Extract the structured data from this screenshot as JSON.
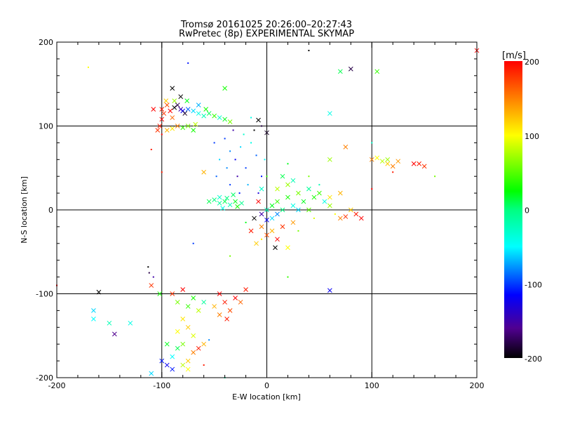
{
  "chart_data": {
    "type": "scatter",
    "title": "Tromsø 20161025 20:26:00–20:27:43",
    "subtitle": "RwPretec (8p) EXPERIMENTAL SKYMAP",
    "xlabel": "E-W location [km]",
    "ylabel": "N-S location [km]",
    "xlim": [
      -200,
      200
    ],
    "ylim": [
      -200,
      200
    ],
    "xticks": [
      "-200",
      "-100",
      "0",
      "100",
      "200"
    ],
    "yticks": [
      "-200",
      "-100",
      "0",
      "100",
      "200"
    ],
    "grid": true,
    "colorbar": {
      "label": "[m/s]",
      "range": [
        -200,
        200
      ],
      "ticks": [
        "200",
        "100",
        "0",
        "-100",
        "-200"
      ],
      "stops": [
        [
          -200,
          "#000000"
        ],
        [
          -160,
          "#500090"
        ],
        [
          -115,
          "#0000ff"
        ],
        [
          -50,
          "#00ffff"
        ],
        [
          0,
          "#00ff80"
        ],
        [
          25,
          "#00ff00"
        ],
        [
          100,
          "#ffff00"
        ],
        [
          150,
          "#ff8000"
        ],
        [
          200,
          "#ff0000"
        ]
      ]
    },
    "point_fields": [
      "x_km",
      "y_km",
      "velocity_mps",
      "cross_marker"
    ],
    "points": [
      [
        -100,
        120,
        190,
        1
      ],
      [
        -98,
        115,
        180,
        1
      ],
      [
        -95,
        125,
        170,
        1
      ],
      [
        -92,
        118,
        200,
        1
      ],
      [
        -90,
        110,
        160,
        1
      ],
      [
        -88,
        122,
        -200,
        1
      ],
      [
        -85,
        125,
        -180,
        1
      ],
      [
        -82,
        120,
        -150,
        1
      ],
      [
        -80,
        118,
        -120,
        1
      ],
      [
        -78,
        115,
        -190,
        1
      ],
      [
        -75,
        120,
        -90,
        1
      ],
      [
        -70,
        118,
        -60,
        1
      ],
      [
        -65,
        115,
        -40,
        1
      ],
      [
        -60,
        112,
        -20,
        1
      ],
      [
        -55,
        115,
        10,
        1
      ],
      [
        -50,
        112,
        40,
        1
      ],
      [
        -45,
        110,
        -30,
        1
      ],
      [
        -40,
        108,
        20,
        1
      ],
      [
        -35,
        105,
        60,
        1
      ],
      [
        -102,
        100,
        190,
        1
      ],
      [
        -95,
        95,
        130,
        1
      ],
      [
        -90,
        97,
        110,
        1
      ],
      [
        -85,
        100,
        150,
        1
      ],
      [
        -80,
        98,
        40,
        1
      ],
      [
        -75,
        100,
        60,
        1
      ],
      [
        -70,
        95,
        30,
        1
      ],
      [
        -68,
        102,
        80,
        1
      ],
      [
        -100,
        108,
        200,
        1
      ],
      [
        -104,
        95,
        180,
        1
      ],
      [
        -108,
        120,
        200,
        1
      ],
      [
        -96,
        130,
        120,
        1
      ],
      [
        -88,
        130,
        70,
        1
      ],
      [
        -82,
        135,
        -200,
        1
      ],
      [
        -76,
        130,
        20,
        1
      ],
      [
        -65,
        125,
        -70,
        1
      ],
      [
        -58,
        120,
        30,
        1
      ],
      [
        -100,
        90,
        200,
        0
      ],
      [
        -110,
        72,
        190,
        0
      ],
      [
        -40,
        85,
        -100,
        0
      ],
      [
        -35,
        70,
        -80,
        0
      ],
      [
        -30,
        60,
        -120,
        0
      ],
      [
        -25,
        75,
        -60,
        0
      ],
      [
        -20,
        50,
        -100,
        0
      ],
      [
        -15,
        80,
        -40,
        0
      ],
      [
        -10,
        65,
        -90,
        0
      ],
      [
        -5,
        40,
        -110,
        0
      ],
      [
        -18,
        30,
        -70,
        0
      ],
      [
        -28,
        40,
        -150,
        0
      ],
      [
        -35,
        30,
        -100,
        0
      ],
      [
        -12,
        95,
        -200,
        0
      ],
      [
        -5,
        100,
        -180,
        0
      ],
      [
        0,
        92,
        -190,
        1
      ],
      [
        -8,
        107,
        -200,
        1
      ],
      [
        -50,
        80,
        -100,
        0
      ],
      [
        -45,
        60,
        -60,
        0
      ],
      [
        -22,
        90,
        -30,
        0
      ],
      [
        -8,
        20,
        -130,
        0
      ],
      [
        -38,
        50,
        -80,
        0
      ],
      [
        -32,
        95,
        -150,
        0
      ],
      [
        -2,
        60,
        -50,
        0
      ],
      [
        -48,
        40,
        -90,
        0
      ],
      [
        -26,
        20,
        -110,
        0
      ],
      [
        -50,
        12,
        0,
        1
      ],
      [
        -45,
        8,
        -10,
        1
      ],
      [
        -40,
        10,
        10,
        1
      ],
      [
        -35,
        6,
        -20,
        1
      ],
      [
        -30,
        10,
        20,
        1
      ],
      [
        -45,
        15,
        -30,
        1
      ],
      [
        -38,
        14,
        0,
        1
      ],
      [
        -28,
        4,
        30,
        1
      ],
      [
        -55,
        10,
        10,
        1
      ],
      [
        -42,
        2,
        -40,
        1
      ],
      [
        -32,
        18,
        5,
        1
      ],
      [
        -24,
        8,
        -5,
        1
      ],
      [
        0,
        0,
        -20,
        1
      ],
      [
        5,
        5,
        20,
        1
      ],
      [
        10,
        10,
        40,
        1
      ],
      [
        15,
        0,
        0,
        1
      ],
      [
        20,
        15,
        30,
        1
      ],
      [
        25,
        5,
        -40,
        1
      ],
      [
        30,
        20,
        60,
        1
      ],
      [
        35,
        10,
        20,
        1
      ],
      [
        40,
        25,
        -10,
        1
      ],
      [
        45,
        15,
        30,
        1
      ],
      [
        5,
        -10,
        -60,
        1
      ],
      [
        10,
        -5,
        -80,
        1
      ],
      [
        0,
        -12,
        -120,
        1
      ],
      [
        -5,
        -5,
        -150,
        1
      ],
      [
        20,
        30,
        70,
        1
      ],
      [
        15,
        40,
        10,
        1
      ],
      [
        25,
        35,
        -20,
        1
      ],
      [
        50,
        20,
        40,
        1
      ],
      [
        55,
        10,
        -40,
        1
      ],
      [
        30,
        0,
        -60,
        1
      ],
      [
        -5,
        -20,
        150,
        1
      ],
      [
        0,
        -30,
        170,
        1
      ],
      [
        5,
        -25,
        130,
        1
      ],
      [
        10,
        -35,
        200,
        1
      ],
      [
        15,
        -20,
        180,
        1
      ],
      [
        -10,
        -40,
        120,
        1
      ],
      [
        20,
        -45,
        100,
        1
      ],
      [
        -15,
        -25,
        190,
        1
      ],
      [
        25,
        -15,
        140,
        1
      ],
      [
        8,
        -45,
        -200,
        1
      ],
      [
        -12,
        -10,
        -200,
        1
      ],
      [
        -5,
        -35,
        110,
        0
      ],
      [
        -8,
        10,
        200,
        1
      ],
      [
        -5,
        25,
        -30,
        1
      ],
      [
        10,
        25,
        80,
        1
      ],
      [
        40,
        0,
        50,
        1
      ],
      [
        60,
        5,
        70,
        1
      ],
      [
        65,
        -5,
        100,
        0
      ],
      [
        70,
        -10,
        150,
        1
      ],
      [
        75,
        -8,
        180,
        1
      ],
      [
        80,
        0,
        120,
        1
      ],
      [
        85,
        -5,
        190,
        1
      ],
      [
        90,
        -10,
        200,
        1
      ],
      [
        45,
        -10,
        90,
        0
      ],
      [
        30,
        -25,
        60,
        0
      ],
      [
        60,
        15,
        110,
        1
      ],
      [
        70,
        20,
        130,
        1
      ],
      [
        0,
        40,
        40,
        0
      ],
      [
        20,
        55,
        20,
        0
      ],
      [
        40,
        40,
        60,
        0
      ],
      [
        50,
        30,
        -20,
        0
      ],
      [
        100,
        60,
        150,
        1
      ],
      [
        105,
        62,
        100,
        1
      ],
      [
        110,
        58,
        80,
        1
      ],
      [
        115,
        55,
        120,
        1
      ],
      [
        120,
        52,
        150,
        1
      ],
      [
        115,
        60,
        70,
        1
      ],
      [
        140,
        55,
        200,
        1
      ],
      [
        145,
        55,
        190,
        1
      ],
      [
        150,
        52,
        180,
        1
      ],
      [
        125,
        58,
        140,
        1
      ],
      [
        120,
        45,
        190,
        0
      ],
      [
        100,
        25,
        200,
        0
      ],
      [
        160,
        40,
        60,
        0
      ],
      [
        -90,
        -100,
        180,
        1
      ],
      [
        -85,
        -110,
        60,
        1
      ],
      [
        -80,
        -95,
        200,
        1
      ],
      [
        -75,
        -115,
        40,
        1
      ],
      [
        -70,
        -105,
        30,
        1
      ],
      [
        -65,
        -120,
        80,
        1
      ],
      [
        -60,
        -110,
        -10,
        1
      ],
      [
        -80,
        -130,
        110,
        1
      ],
      [
        -75,
        -140,
        120,
        1
      ],
      [
        -70,
        -150,
        90,
        1
      ],
      [
        -85,
        -145,
        100,
        1
      ],
      [
        -80,
        -160,
        60,
        1
      ],
      [
        -70,
        -170,
        150,
        1
      ],
      [
        -75,
        -180,
        120,
        1
      ],
      [
        -90,
        -175,
        -50,
        1
      ],
      [
        -95,
        -185,
        -120,
        1
      ],
      [
        -90,
        -190,
        -110,
        1
      ],
      [
        -80,
        -185,
        80,
        1
      ],
      [
        -85,
        -165,
        10,
        1
      ],
      [
        -65,
        -165,
        190,
        1
      ],
      [
        -60,
        -160,
        130,
        1
      ],
      [
        -95,
        -160,
        20,
        1
      ],
      [
        -45,
        -100,
        200,
        1
      ],
      [
        -40,
        -110,
        190,
        1
      ],
      [
        -35,
        -120,
        170,
        1
      ],
      [
        -30,
        -105,
        200,
        1
      ],
      [
        -45,
        -125,
        150,
        1
      ],
      [
        -38,
        -130,
        190,
        1
      ],
      [
        -25,
        -110,
        160,
        1
      ],
      [
        -50,
        -115,
        130,
        1
      ],
      [
        -20,
        -95,
        190,
        1
      ],
      [
        -110,
        -90,
        180,
        1
      ],
      [
        -113,
        -68,
        -200,
        0
      ],
      [
        -112,
        -75,
        -180,
        0
      ],
      [
        -108,
        -80,
        -150,
        0
      ],
      [
        -160,
        -98,
        -200,
        1
      ],
      [
        -165,
        -120,
        -60,
        1
      ],
      [
        -165,
        -130,
        -50,
        1
      ],
      [
        -150,
        -135,
        -20,
        1
      ],
      [
        -145,
        -148,
        -160,
        1
      ],
      [
        -130,
        -135,
        -40,
        1
      ],
      [
        -110,
        -195,
        -60,
        1
      ],
      [
        -100,
        -180,
        -110,
        1
      ],
      [
        -60,
        -185,
        190,
        0
      ],
      [
        -75,
        -190,
        100,
        1
      ],
      [
        -55,
        -155,
        -80,
        0
      ],
      [
        -102,
        -100,
        30,
        1
      ],
      [
        60,
        -96,
        -120,
        1
      ],
      [
        60,
        115,
        -40,
        1
      ],
      [
        70,
        165,
        10,
        1
      ],
      [
        80,
        168,
        -180,
        1
      ],
      [
        105,
        165,
        40,
        1
      ],
      [
        200,
        190,
        200,
        1
      ],
      [
        -170,
        170,
        100,
        0
      ],
      [
        -75,
        175,
        -110,
        0
      ],
      [
        40,
        190,
        -200,
        0
      ],
      [
        75,
        75,
        150,
        1
      ],
      [
        100,
        80,
        -30,
        0
      ],
      [
        60,
        60,
        70,
        1
      ],
      [
        -90,
        145,
        -200,
        1
      ],
      [
        -40,
        145,
        30,
        1
      ],
      [
        -60,
        45,
        130,
        1
      ],
      [
        -100,
        45,
        190,
        0
      ],
      [
        -15,
        110,
        -40,
        0
      ],
      [
        -35,
        -55,
        60,
        0
      ],
      [
        -70,
        -40,
        -100,
        0
      ],
      [
        20,
        -80,
        40,
        0
      ],
      [
        -20,
        -15,
        20,
        0
      ],
      [
        -200,
        -90,
        200,
        0
      ],
      [
        -40,
        -200,
        -20,
        0
      ]
    ]
  }
}
